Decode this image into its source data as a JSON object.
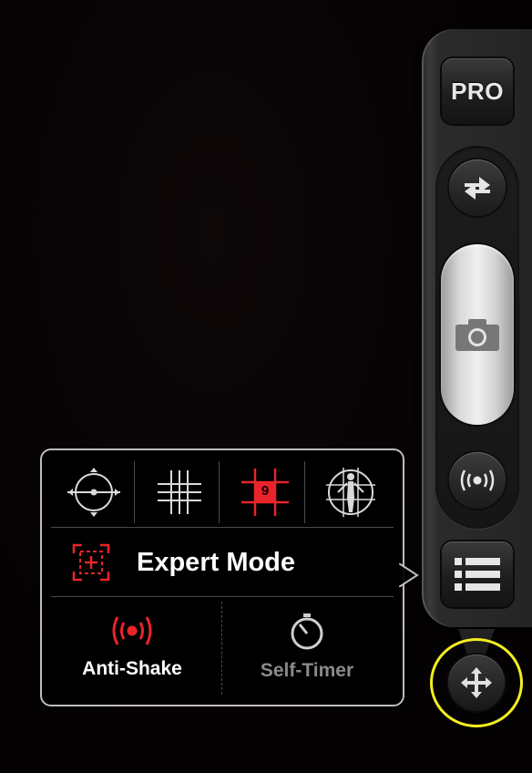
{
  "sidebar": {
    "pro_label": "PRO",
    "switch_camera_icon": "swap-arrows-icon",
    "shutter_icon": "camera-icon",
    "antishake_icon": "vibration-icon",
    "menu_icon": "list-icon",
    "move_icon": "four-way-arrows-icon"
  },
  "popover": {
    "grid_options": [
      {
        "icon": "crosshair-level-icon",
        "selected": false
      },
      {
        "icon": "grid-icon",
        "selected": false
      },
      {
        "icon": "grid-nine-icon",
        "badge": "9",
        "selected": true
      },
      {
        "icon": "vitruvian-grid-icon",
        "selected": false
      }
    ],
    "expert_mode_label": "Expert Mode",
    "anti_shake_label": "Anti-Shake",
    "self_timer_label": "Self-Timer"
  },
  "colors": {
    "accent_red": "#e8242a",
    "highlight_yellow": "#f4ee1f",
    "popover_border": "#bdbdbd",
    "disabled_text": "#8a8a8a"
  }
}
